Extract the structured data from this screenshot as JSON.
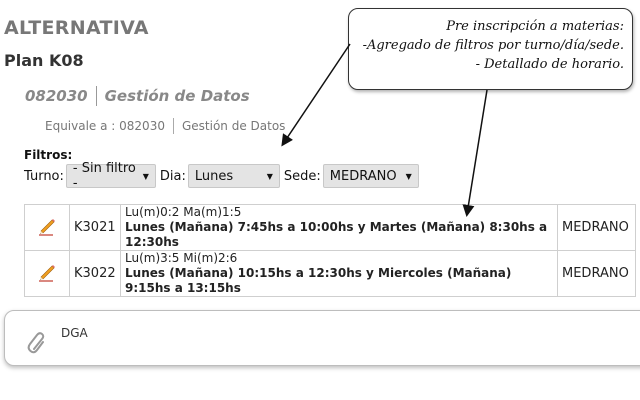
{
  "header": {
    "title": "ALTERNATIVA",
    "plan": "Plan K08"
  },
  "subject": {
    "code": "082030",
    "name": "Gestión de Datos"
  },
  "equivalence": {
    "label": "Equivale a : 082030",
    "name": "Gestión de Datos"
  },
  "filters": {
    "title": "Filtros:",
    "turno_label": "Turno:",
    "turno_value": "- Sin filtro -",
    "dia_label": "Dia:",
    "dia_value": "Lunes",
    "sede_label": "Sede:",
    "sede_value": "MEDRANO"
  },
  "courses": [
    {
      "code": "K3021",
      "schedule_short": "Lu(m)0:2 Ma(m)1:5",
      "schedule_long": "Lunes (Mañana) 7:45hs a 10:00hs y Martes (Mañana) 8:30hs a 12:30hs",
      "sede": "MEDRANO"
    },
    {
      "code": "K3022",
      "schedule_short": "Lu(m)3:5 Mi(m)2:6",
      "schedule_long": "Lunes (Mañana) 10:15hs a 12:30hs y Miercoles (Mañana) 9:15hs a 13:15hs",
      "sede": "MEDRANO"
    }
  ],
  "attachment": {
    "label": "DGA"
  },
  "callout": {
    "line1": "Pre inscripción a materias:",
    "line2": "-Agregado de filtros por turno/día/sede.",
    "line3": "- Detallado de horario."
  },
  "icons": {
    "edit": "pencil-icon",
    "attachment": "paperclip-icon",
    "dropdown": "caret-down-icon"
  },
  "colors": {
    "pencil_body": "#f0a020",
    "pencil_tip": "#c0392b",
    "select_bg": "#e4e4e4"
  }
}
